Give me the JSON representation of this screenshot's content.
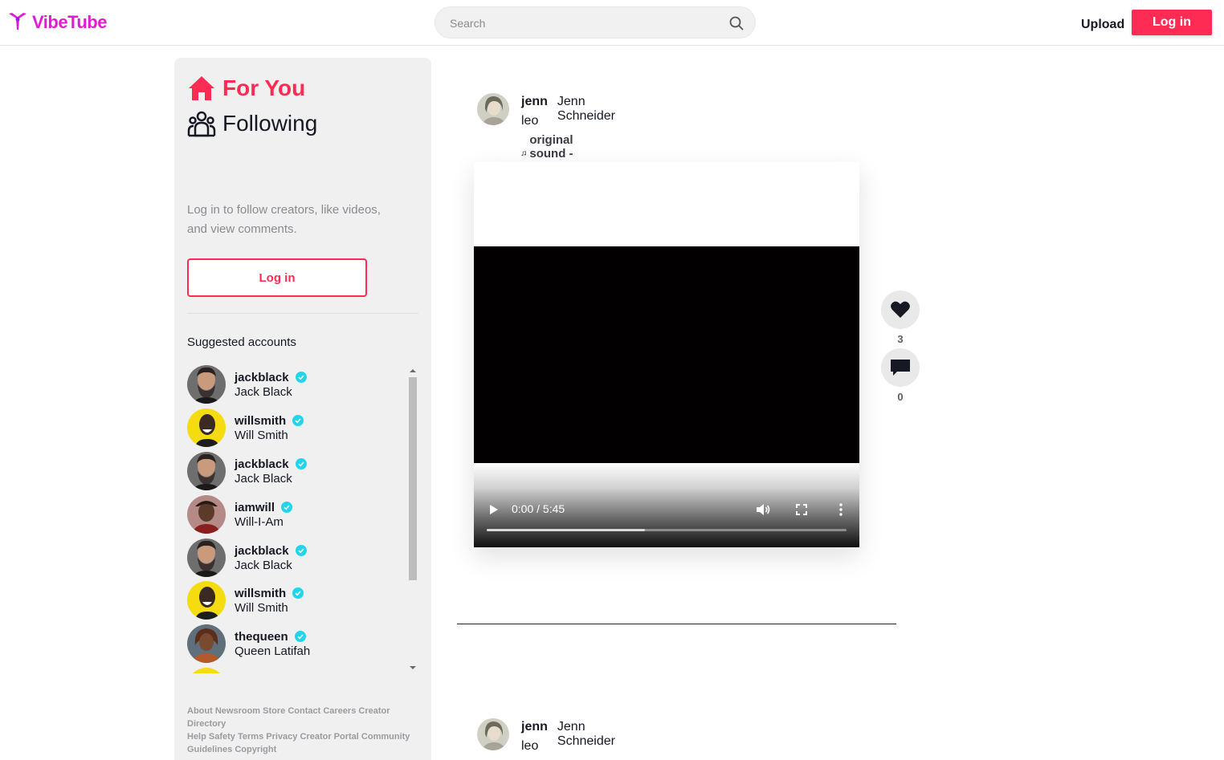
{
  "header": {
    "logo_text": "VibeTube",
    "search_placeholder": "Search",
    "upload_label": "Upload",
    "login_label": "Log in",
    "brand_color": "#fe2c55",
    "logo_color": "#e01bd2"
  },
  "sidebar": {
    "nav": [
      {
        "label": "For You",
        "icon": "home-icon",
        "active": true
      },
      {
        "label": "Following",
        "icon": "users-icon",
        "active": false
      }
    ],
    "login_hint": "Log in to follow creators, like videos, and view comments.",
    "login_label": "Log in",
    "suggested_title": "Suggested accounts",
    "accounts": [
      {
        "handle": "jackblack",
        "name": "Jack Black",
        "verified": true
      },
      {
        "handle": "willsmith",
        "name": "Will Smith",
        "verified": true
      },
      {
        "handle": "jackblack",
        "name": "Jack Black",
        "verified": true
      },
      {
        "handle": "iamwill",
        "name": "Will-I-Am",
        "verified": true
      },
      {
        "handle": "jackblack",
        "name": "Jack Black",
        "verified": true
      },
      {
        "handle": "willsmith",
        "name": "Will Smith",
        "verified": true
      },
      {
        "handle": "thequeen",
        "name": "Queen Latifah",
        "verified": true
      }
    ],
    "footer_row1": [
      "About",
      "Newsroom",
      "Store",
      "Contact",
      "Careers",
      "Creator Directory"
    ],
    "footer_row2": [
      "Help",
      "Safety",
      "Terms",
      "Privacy",
      "Creator Portal",
      "Community Guidelines",
      "Copyright"
    ]
  },
  "feed": {
    "posts": [
      {
        "handle": "jenn",
        "name": "Jenn Schneider",
        "caption": "leo",
        "sound": "original sound - jenn",
        "time": "0:00 / 5:45",
        "likes": "3",
        "comments": "0",
        "buffered_fraction": 0.44
      },
      {
        "handle": "jenn",
        "name": "Jenn Schneider",
        "caption": "leo"
      }
    ]
  }
}
